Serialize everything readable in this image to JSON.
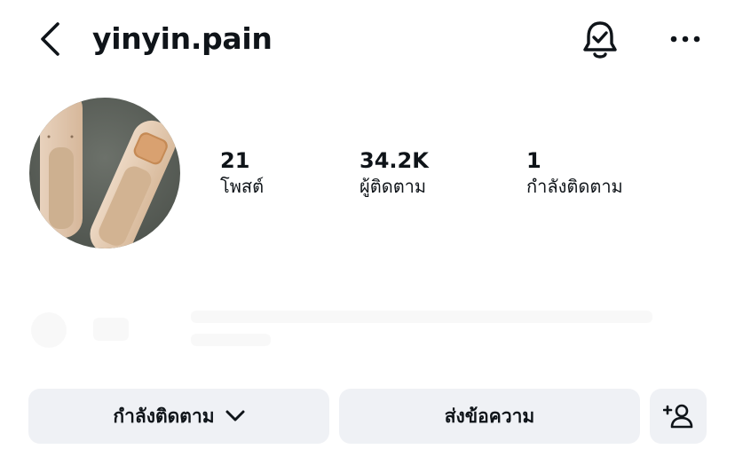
{
  "header": {
    "username": "yinyin.pain",
    "icons": {
      "back": "chevron-left-icon",
      "notifications": "bell-check-icon",
      "more": "more-horizontal-icon"
    }
  },
  "profile": {
    "avatar": "profile-photo"
  },
  "stats": {
    "posts": {
      "value": "21",
      "label": "โพสต์"
    },
    "followers": {
      "value": "34.2K",
      "label": "ผู้ติดตาม"
    },
    "following": {
      "value": "1",
      "label": "กำลังติดตาม"
    }
  },
  "actions": {
    "following_label": "กำลังติดตาม",
    "message_label": "ส่งข้อความ",
    "add_icon": "add-person-icon",
    "dropdown_icon": "chevron-down-icon"
  },
  "colors": {
    "text": "#0f1419",
    "button_bg": "#eff1f5",
    "background": "#ffffff"
  }
}
